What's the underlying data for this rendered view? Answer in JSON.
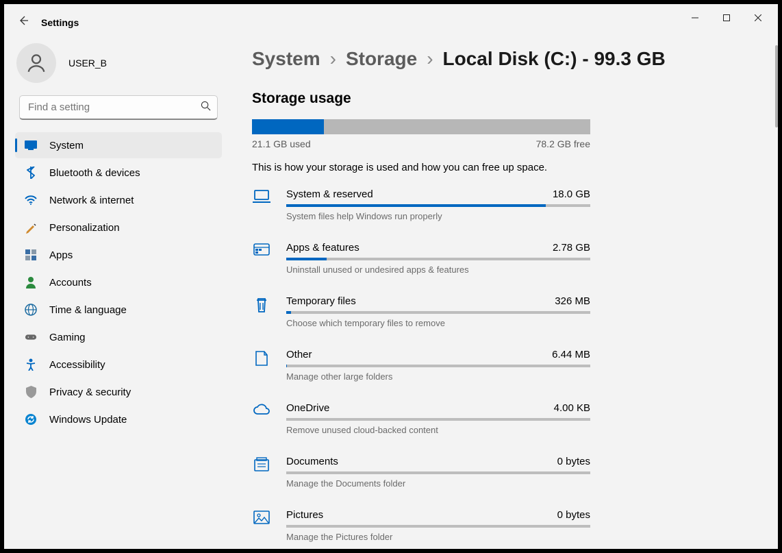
{
  "app_title": "Settings",
  "user": {
    "name": "USER_B"
  },
  "search": {
    "placeholder": "Find a setting"
  },
  "nav": {
    "items": [
      {
        "label": "System",
        "icon": "system"
      },
      {
        "label": "Bluetooth & devices",
        "icon": "bluetooth"
      },
      {
        "label": "Network & internet",
        "icon": "wifi"
      },
      {
        "label": "Personalization",
        "icon": "brush"
      },
      {
        "label": "Apps",
        "icon": "apps"
      },
      {
        "label": "Accounts",
        "icon": "account"
      },
      {
        "label": "Time & language",
        "icon": "globe"
      },
      {
        "label": "Gaming",
        "icon": "gaming"
      },
      {
        "label": "Accessibility",
        "icon": "accessibility"
      },
      {
        "label": "Privacy & security",
        "icon": "shield"
      },
      {
        "label": "Windows Update",
        "icon": "update"
      }
    ],
    "active_index": 0
  },
  "breadcrumb": {
    "parts": [
      "System",
      "Storage"
    ],
    "current": "Local Disk (C:) - 99.3 GB"
  },
  "storage": {
    "section_title": "Storage usage",
    "used_text": "21.1 GB used",
    "free_text": "78.2 GB free",
    "used_pct": 21.3,
    "description": "This is how your storage is used and how you can free up space.",
    "categories": [
      {
        "title": "System & reserved",
        "size": "18.0 GB",
        "subtitle": "System files help Windows run properly",
        "pct": 85.3,
        "icon": "laptop"
      },
      {
        "title": "Apps & features",
        "size": "2.78 GB",
        "subtitle": "Uninstall unused or undesired apps & features",
        "pct": 13.2,
        "icon": "apps2"
      },
      {
        "title": "Temporary files",
        "size": "326 MB",
        "subtitle": "Choose which temporary files to remove",
        "pct": 1.5,
        "icon": "trash"
      },
      {
        "title": "Other",
        "size": "6.44 MB",
        "subtitle": "Manage other large folders",
        "pct": 0.03,
        "icon": "other"
      },
      {
        "title": "OneDrive",
        "size": "4.00 KB",
        "subtitle": "Remove unused cloud-backed content",
        "pct": 0,
        "icon": "cloud"
      },
      {
        "title": "Documents",
        "size": "0 bytes",
        "subtitle": "Manage the Documents folder",
        "pct": 0,
        "icon": "documents"
      },
      {
        "title": "Pictures",
        "size": "0 bytes",
        "subtitle": "Manage the Pictures folder",
        "pct": 0,
        "icon": "pictures"
      }
    ]
  }
}
